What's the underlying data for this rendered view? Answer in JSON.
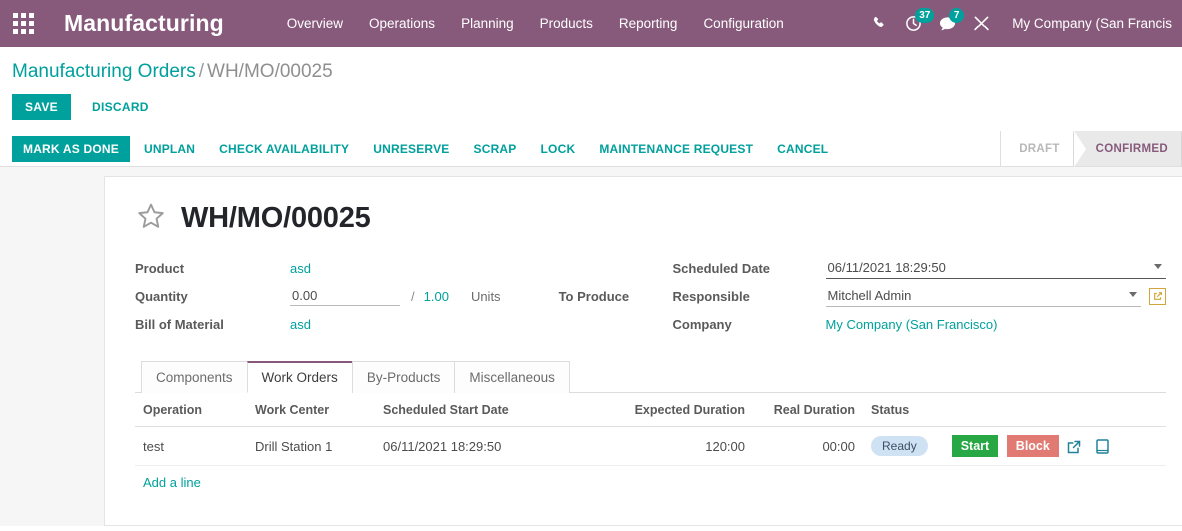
{
  "navbar": {
    "apps_icon": "apps-grid-icon",
    "brand": "Manufacturing",
    "menu": [
      {
        "label": "Overview"
      },
      {
        "label": "Operations"
      },
      {
        "label": "Planning"
      },
      {
        "label": "Products"
      },
      {
        "label": "Reporting"
      },
      {
        "label": "Configuration"
      }
    ],
    "icons": {
      "phone": "phone-icon",
      "activities": "clock-icon",
      "activities_count": "37",
      "messages": "chat-bubble-icon",
      "messages_count": "7",
      "tools": "wrench-screwdriver-icon"
    },
    "company": "My Company (San Francis",
    "brand_color": "#875a7b",
    "badge_color": "#00a09d"
  },
  "breadcrumb": {
    "root": "Manufacturing Orders",
    "separator": "/",
    "current": "WH/MO/00025"
  },
  "save_row": {
    "save_label": "SAVE",
    "discard_label": "DISCARD"
  },
  "action_bar": {
    "primary": "MARK AS DONE",
    "buttons": [
      {
        "label": "UNPLAN"
      },
      {
        "label": "CHECK AVAILABILITY"
      },
      {
        "label": "UNRESERVE"
      },
      {
        "label": "SCRAP"
      },
      {
        "label": "LOCK"
      },
      {
        "label": "MAINTENANCE REQUEST"
      },
      {
        "label": "CANCEL"
      }
    ],
    "statusbar": [
      {
        "label": "DRAFT",
        "active": false
      },
      {
        "label": "CONFIRMED",
        "active": true
      }
    ],
    "active_color": "#875a7b"
  },
  "record": {
    "favorite_icon": "star-icon",
    "title": "WH/MO/00025"
  },
  "form": {
    "left": {
      "product_label": "Product",
      "product_value": "asd",
      "quantity_label": "Quantity",
      "quantity_value": "0.00",
      "quantity_separator": "/",
      "quantity_total": "1.00",
      "quantity_uom": "Units",
      "to_produce_label": "To Produce",
      "bom_label": "Bill of Material",
      "bom_value": "asd"
    },
    "right": {
      "scheduled_date_label": "Scheduled Date",
      "scheduled_date_value": "06/11/2021 18:29:50",
      "responsible_label": "Responsible",
      "responsible_value": "Mitchell Admin",
      "company_label": "Company",
      "company_value": "My Company (San Francisco)"
    }
  },
  "notebook": {
    "tabs": [
      {
        "label": "Components",
        "active": false
      },
      {
        "label": "Work Orders",
        "active": true
      },
      {
        "label": "By-Products",
        "active": false
      },
      {
        "label": "Miscellaneous",
        "active": false
      }
    ]
  },
  "work_orders": {
    "columns": [
      "Operation",
      "Work Center",
      "Scheduled Start Date",
      "Expected Duration",
      "Real Duration",
      "Status"
    ],
    "rows": [
      {
        "operation": "test",
        "work_center": "Drill Station 1",
        "scheduled_start_date": "06/11/2021 18:29:50",
        "expected_duration": "120:00",
        "real_duration": "00:00",
        "status": "Ready",
        "start_label": "Start",
        "block_label": "Block",
        "open_icon": "external-link-icon",
        "tablet_icon": "tablet-icon"
      }
    ],
    "add_line_label": "Add a line",
    "start_color": "#28a745",
    "block_color": "#e07a72",
    "status_badge_color": "#cfe2f3"
  }
}
